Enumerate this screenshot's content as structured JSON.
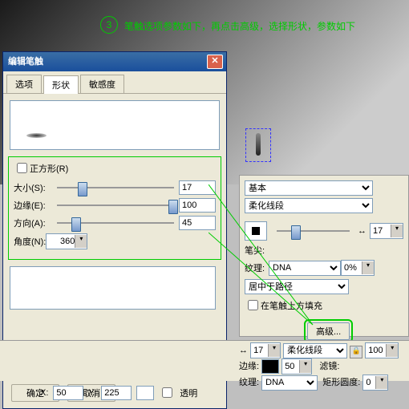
{
  "step": {
    "num": "3",
    "text": "笔触选项参数如下，再点击高级，选择形状，参数如下"
  },
  "dialog": {
    "title": "编辑笔触",
    "tabs": {
      "options": "选项",
      "shape": "形状",
      "sensitivity": "敏感度"
    },
    "square_label": "正方形(R)",
    "size_label": "大小(S):",
    "size_val": "17",
    "edge_label": "边缘(E):",
    "edge_val": "100",
    "dir_label": "方向(A):",
    "dir_val": "45",
    "angle_label": "角度(N):",
    "angle_val": "360",
    "ok": "确定",
    "cancel": "取消"
  },
  "panel": {
    "basic": "基本",
    "softline": "柔化线段",
    "tip_label": "笔尖:",
    "tip_val": "17",
    "texture_label": "纹理:",
    "texture_val": "DNA",
    "texture_pct": "0%",
    "center": "居中于路径",
    "fill_above": "在笔触上方填充",
    "advanced": "高级..."
  },
  "bottom": {
    "size_val": "17",
    "style": "柔化线段",
    "opacity": "100",
    "edge_label": "边缘:",
    "edge_val": "50",
    "texture_label": "纹理:",
    "texture_val": "DNA",
    "filter_label": "滤镜:",
    "rect_label": "矩形圆度:",
    "rect_val": "0"
  },
  "coords": {
    "x_val": "50",
    "y_val": "225",
    "transparent": "透明"
  }
}
